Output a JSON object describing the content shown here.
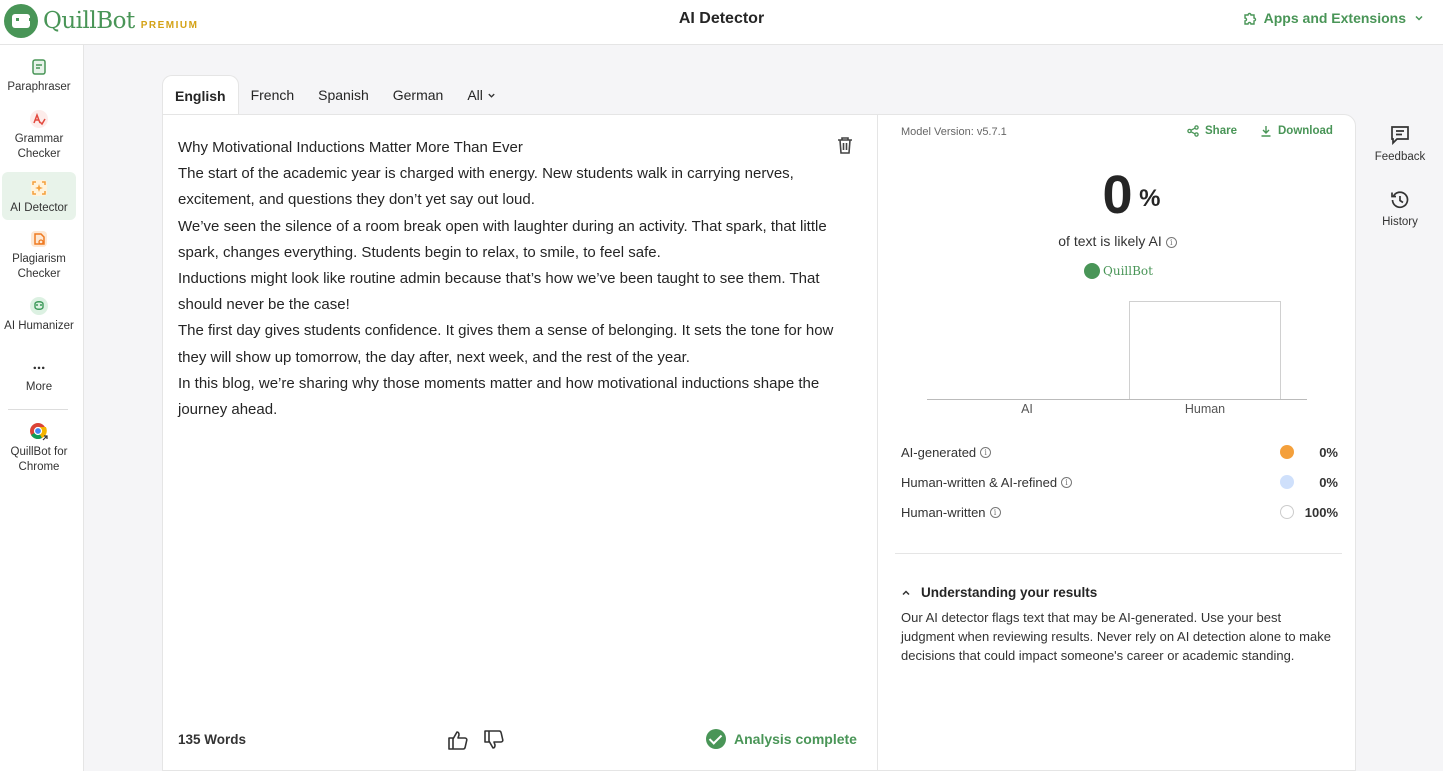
{
  "header": {
    "logo_text": "QuillBot",
    "logo_badge": "PREMIUM",
    "title": "AI Detector",
    "apps_link": "Apps and Extensions"
  },
  "sidebar": {
    "items": [
      {
        "label": "Paraphraser",
        "icon": "paraphraser-icon"
      },
      {
        "label": "Grammar Checker",
        "icon": "grammar-checker-icon"
      },
      {
        "label": "AI Detector",
        "icon": "ai-detector-icon",
        "active": true
      },
      {
        "label": "Plagiarism Checker",
        "icon": "plagiarism-checker-icon"
      },
      {
        "label": "AI Humanizer",
        "icon": "ai-humanizer-icon"
      },
      {
        "label": "More",
        "icon": "more-dots-icon"
      },
      {
        "label": "QuillBot for Chrome",
        "icon": "chrome-icon"
      }
    ]
  },
  "tabs": {
    "items": [
      "English",
      "French",
      "Spanish",
      "German"
    ],
    "all_label": "All",
    "selected": "English"
  },
  "editor": {
    "paragraphs": [
      "Why Motivational Inductions Matter More Than Ever",
      "The start of the academic year is charged with energy. New students walk in carrying nerves, excitement, and questions they don’t yet say out loud.",
      "We’ve seen the silence of a room break open with laughter during an activity. That spark, that little spark, changes everything. Students begin to relax, to smile, to feel safe.",
      "Inductions might look like routine admin because that’s how we’ve been taught to see them. That should never be the case!",
      "The first day gives students confidence. It gives them a sense of belonging. It sets the tone for how they will show up tomorrow, the day after, next week, and the rest of the year.",
      "In this blog, we’re sharing why those moments matter and how motivational inductions shape the journey ahead."
    ],
    "word_count": "135 Words",
    "status": "Analysis complete"
  },
  "results": {
    "model_version": "Model Version: v5.7.1",
    "share_label": "Share",
    "download_label": "Download",
    "score_value": "0",
    "score_unit": "%",
    "score_caption": "of text is likely AI",
    "brand_text": "QuillBot",
    "breakdown": [
      {
        "label": "AI-generated",
        "value": "0%",
        "color": "#f4a03c"
      },
      {
        "label": "Human-written & AI-refined",
        "value": "0%",
        "color": "#cfe0fb"
      },
      {
        "label": "Human-written",
        "value": "100%",
        "color": "#ffffff"
      }
    ],
    "understanding_title": "Understanding your results",
    "understanding_text": "Our AI detector flags text that may be AI-generated. Use your best judgment when reviewing results. Never rely on AI detection alone to make decisions that could impact someone's career or academic standing."
  },
  "chart_data": {
    "type": "bar",
    "categories": [
      "AI",
      "Human"
    ],
    "values": [
      0,
      100
    ],
    "ylim": [
      0,
      100
    ]
  },
  "rail": {
    "feedback_label": "Feedback",
    "history_label": "History"
  },
  "colors": {
    "brand": "#499557",
    "premium": "#d4a216"
  }
}
